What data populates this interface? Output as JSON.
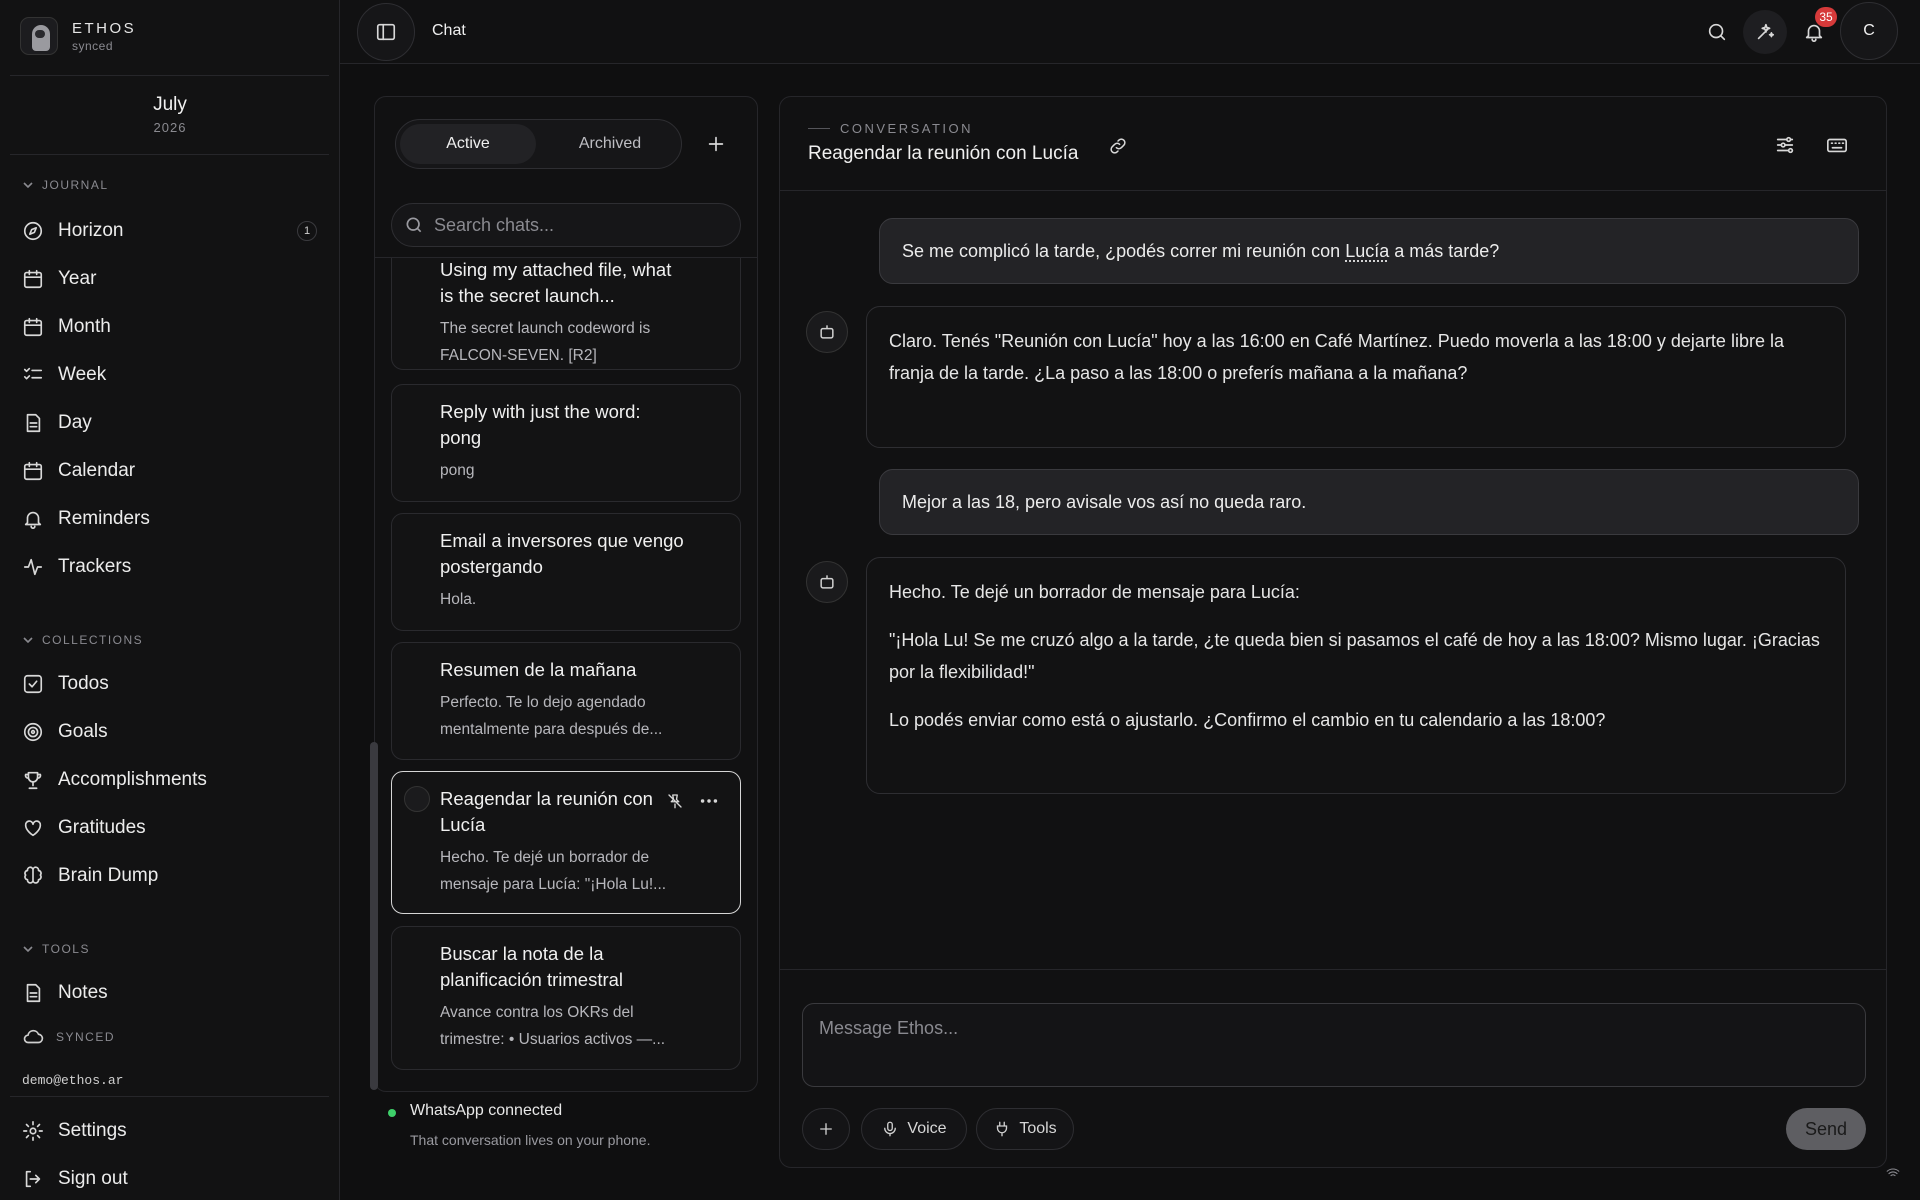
{
  "brand": {
    "name": "ETHOS",
    "status": "synced"
  },
  "date": {
    "month": "July",
    "year": "2026"
  },
  "sections": {
    "journal": "JOURNAL",
    "collections": "COLLECTIONS",
    "tools": "TOOLS"
  },
  "journal_items": [
    {
      "label": "Horizon",
      "icon": "compass-icon",
      "badge": "1"
    },
    {
      "label": "Year",
      "icon": "calendar-icon"
    },
    {
      "label": "Month",
      "icon": "calendar-icon"
    },
    {
      "label": "Week",
      "icon": "list-check-icon"
    },
    {
      "label": "Day",
      "icon": "document-icon"
    },
    {
      "label": "Calendar",
      "icon": "calendar-icon"
    },
    {
      "label": "Reminders",
      "icon": "bell-icon"
    },
    {
      "label": "Trackers",
      "icon": "activity-icon"
    }
  ],
  "collection_items": [
    {
      "label": "Todos",
      "icon": "checkbox-icon"
    },
    {
      "label": "Goals",
      "icon": "target-icon"
    },
    {
      "label": "Accomplishments",
      "icon": "trophy-icon"
    },
    {
      "label": "Gratitudes",
      "icon": "heart-icon"
    },
    {
      "label": "Brain Dump",
      "icon": "brain-icon"
    }
  ],
  "tool_items": [
    {
      "label": "Notes",
      "icon": "document-icon"
    }
  ],
  "sync_label": "SYNCED",
  "user_email": "demo@ethos.ar",
  "footer_items": [
    {
      "label": "Settings",
      "icon": "gear-icon"
    },
    {
      "label": "Sign out",
      "icon": "logout-icon"
    }
  ],
  "topbar": {
    "title": "Chat",
    "notification_count": "35",
    "avatar_initial": "C"
  },
  "chat_list": {
    "tabs": [
      "Active",
      "Archived"
    ],
    "search_placeholder": "Search chats...",
    "chats": [
      {
        "title": "Using my attached file, what is the secret launch...",
        "preview": "The secret launch codeword is FALCON-SEVEN. [R2]"
      },
      {
        "title": "Reply with just the word: pong",
        "preview": "pong"
      },
      {
        "title": "Email a inversores que vengo postergando",
        "preview": "Hola."
      },
      {
        "title": "Resumen de la mañana",
        "preview": "Perfecto. Te lo dejo agendado mentalmente para después de..."
      },
      {
        "title": "Reagendar la reunión con Lucía",
        "preview": "Hecho. Te dejé un borrador de mensaje para Lucía: \"¡Hola Lu!...",
        "selected": true
      },
      {
        "title": "Buscar la nota de la planificación trimestral",
        "preview": "Avance contra los OKRs del trimestre: • Usuarios activos —..."
      }
    ]
  },
  "whatsapp": {
    "status": "WhatsApp connected",
    "note": "That conversation lives on your phone."
  },
  "conversation": {
    "eyebrow": "CONVERSATION",
    "title": "Reagendar la reunión con Lucía",
    "messages": [
      {
        "role": "user",
        "before": "Se me complicó la tarde, ¿podés correr mi reunión con ",
        "mention": "Lucía",
        "after": " a más tarde?"
      },
      {
        "role": "assistant",
        "paragraphs": [
          "Claro. Tenés \"Reunión con Lucía\" hoy a las 16:00 en Café Martínez. Puedo moverla a las 18:00 y dejarte libre la franja de la tarde. ¿La paso a las 18:00 o preferís mañana a la mañana?"
        ]
      },
      {
        "role": "user",
        "text": "Mejor a las 18, pero avisale vos así no queda raro."
      },
      {
        "role": "assistant",
        "paragraphs": [
          "Hecho. Te dejé un borrador de mensaje para Lucía:",
          "\"¡Hola Lu! Se me cruzó algo a la tarde, ¿te queda bien si pasamos el café de hoy a las 18:00? Mismo lugar. ¡Gracias por la flexibilidad!\"",
          "Lo podés enviar como está o ajustarlo. ¿Confirmo el cambio en tu calendario a las 18:00?"
        ]
      }
    ]
  },
  "composer": {
    "placeholder": "Message Ethos...",
    "voice": "Voice",
    "tools": "Tools",
    "send": "Send"
  }
}
